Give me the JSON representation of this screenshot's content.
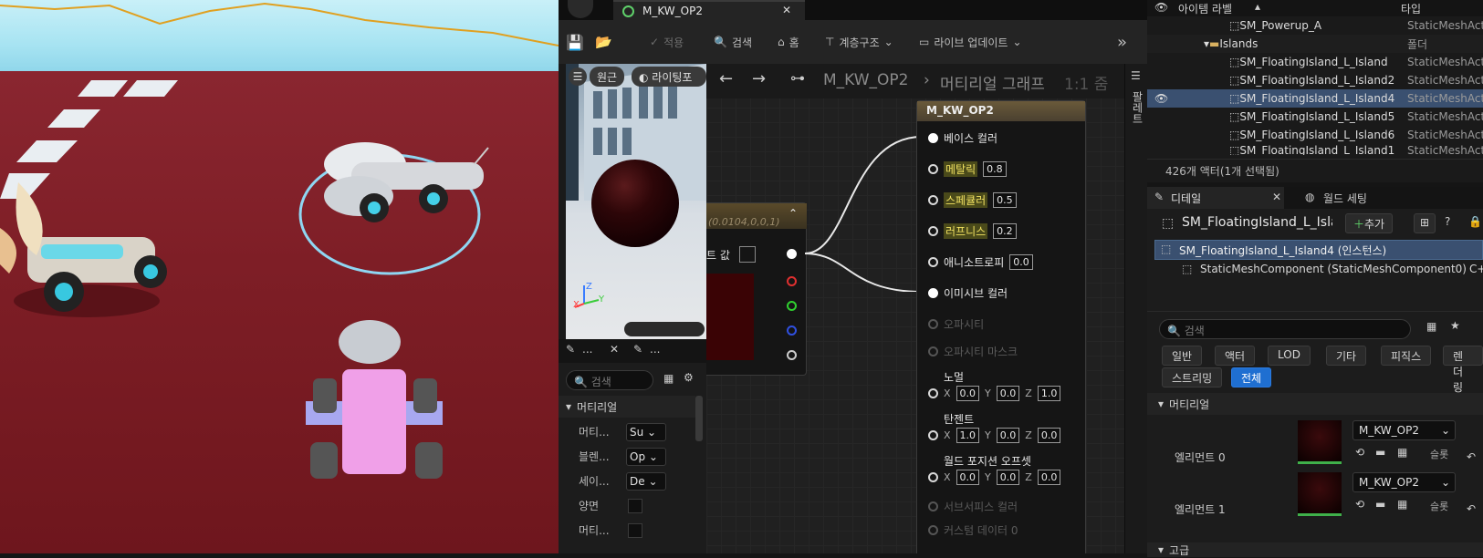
{
  "material_editor": {
    "tab_title": "M_KW_OP2",
    "toolbar": {
      "apply_label": "적용",
      "search_label": "검색",
      "home_label": "홈",
      "hierarchy_label": "계층구조",
      "live_update_label": "라이브 업데이트"
    },
    "preview": {
      "perspective_label": "원근",
      "lighting_label": "라이팅포"
    },
    "breadcrumb": {
      "material": "M_KW_OP2",
      "graph": "머티리얼 그래프",
      "zoom": "1:1 줌"
    },
    "palette_label": "팔레트",
    "details_tab_1": "...",
    "details_tab_2": "...",
    "details_search_placeholder": "검색",
    "details_section": "머티리얼",
    "details_rows": [
      {
        "label": "머티...",
        "value": "Su"
      },
      {
        "label": "블렌...",
        "value": "Op"
      },
      {
        "label": "세이...",
        "value": "De"
      },
      {
        "label": "양면",
        "value": ""
      },
      {
        "label": "머티...",
        "value": ""
      }
    ],
    "constant_node": {
      "value_text": "(0.0104,0,0,1)",
      "param_label": "트 값",
      "swatch_color": "#3a0305"
    },
    "result_node": {
      "title": "M_KW_OP2",
      "base_color": "베이스 컬러",
      "metallic": "메탈릭",
      "metallic_value": "0.8",
      "specular": "스페큘러",
      "specular_value": "0.5",
      "roughness": "러프니스",
      "roughness_value": "0.2",
      "anisotropy": "애니소트로피",
      "anisotropy_value": "0.0",
      "emissive": "이미시브 컬러",
      "opacity": "오파시티",
      "opacity_mask": "오파시티 마스크",
      "normal": "노멀",
      "normal_x": "0.0",
      "normal_y": "0.0",
      "normal_z": "1.0",
      "tangent": "탄젠트",
      "tangent_x": "1.0",
      "tangent_y": "0.0",
      "tangent_z": "0.0",
      "wpo": "월드 포지션 오프셋",
      "wpo_x": "0.0",
      "wpo_y": "0.0",
      "wpo_z": "0.0",
      "subsurface": "서브서피스 컬러",
      "custom_data": "커스텀 데이터 0"
    }
  },
  "outliner": {
    "col_label": "아이템 라벨",
    "col_type": "타입",
    "rows": [
      {
        "label": "SM_Powerup_A",
        "type": "StaticMeshActo"
      },
      {
        "label": "Islands",
        "type": "폴더"
      },
      {
        "label": "SM_FloatingIsland_L_Island",
        "type": "StaticMeshActo"
      },
      {
        "label": "SM_FloatingIsland_L_Island2",
        "type": "StaticMeshActo"
      },
      {
        "label": "SM_FloatingIsland_L_Island4",
        "type": "StaticMeshActo"
      },
      {
        "label": "SM_FloatingIsland_L_Island5",
        "type": "StaticMeshActo"
      },
      {
        "label": "SM_FloatingIsland_L_Island6",
        "type": "StaticMeshActo"
      },
      {
        "label": "SM_FloatingIsland_L_Island1",
        "type": "StaticMeshActo"
      }
    ],
    "footer": "426개 액터(1개 선택됨)"
  },
  "details": {
    "tab_details": "디테일",
    "tab_world": "월드 세팅",
    "actor_name": "SM_FloatingIsland_L_Isla",
    "add_label": "추가",
    "instance_label": "SM_FloatingIsland_L_Island4 (인스턴스)",
    "component_label": "StaticMeshComponent (StaticMeshComponent0)",
    "component_suffix": "C+",
    "search_placeholder": "검색",
    "filters": [
      "일반",
      "액터",
      "LOD",
      "기타",
      "피직스",
      "렌더링",
      "스트리밍",
      "전체"
    ],
    "section_material": "머티리얼",
    "element0_label": "엘리먼트 0",
    "element1_label": "엘리먼트 1",
    "element_material": "M_KW_OP2",
    "slot_label": "슬롯",
    "section_advanced": "고급"
  }
}
